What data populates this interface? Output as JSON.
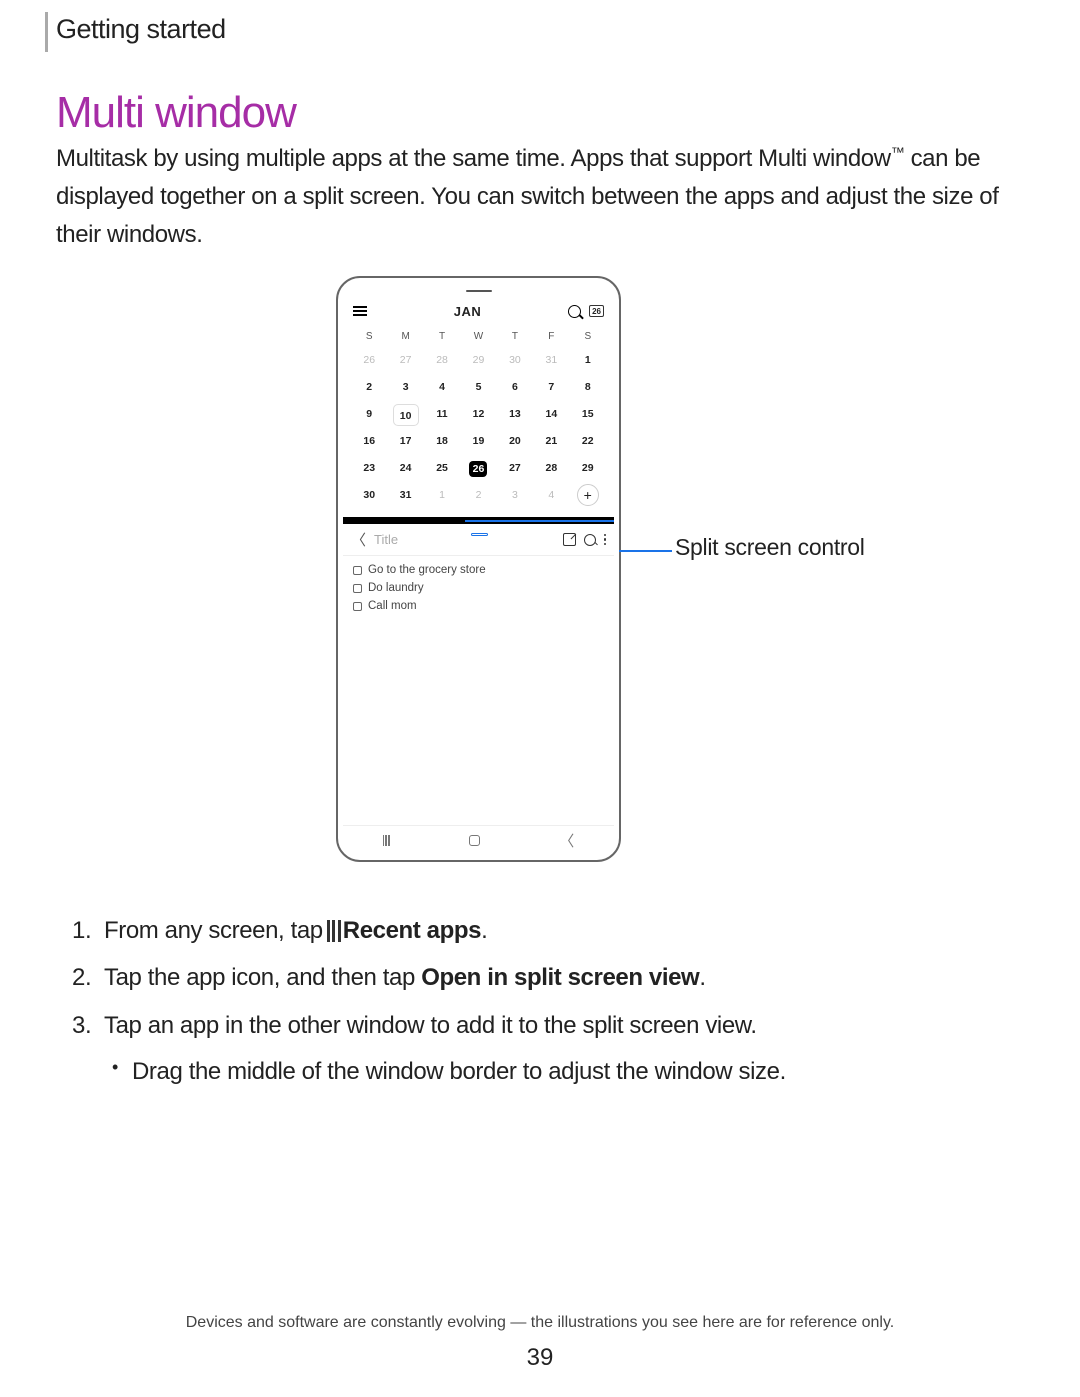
{
  "header": {
    "section": "Getting started"
  },
  "title": "Multi window",
  "intro": {
    "text1": "Multitask by using multiple apps at the same time. Apps that support Multi window",
    "tm": "™",
    "text2": "can be displayed together on a split screen. You can switch between the apps and adjust the size of their windows."
  },
  "callout": "Split screen control",
  "phone": {
    "calendar": {
      "month": "JAN",
      "today_badge": "26",
      "dow": [
        "S",
        "M",
        "T",
        "W",
        "T",
        "F",
        "S"
      ],
      "rows": [
        [
          {
            "d": "26",
            "dim": true
          },
          {
            "d": "27",
            "dim": true
          },
          {
            "d": "28",
            "dim": true
          },
          {
            "d": "29",
            "dim": true
          },
          {
            "d": "30",
            "dim": true
          },
          {
            "d": "31",
            "dim": true
          },
          {
            "d": "1"
          }
        ],
        [
          {
            "d": "2"
          },
          {
            "d": "3"
          },
          {
            "d": "4"
          },
          {
            "d": "5"
          },
          {
            "d": "6"
          },
          {
            "d": "7"
          },
          {
            "d": "8"
          }
        ],
        [
          {
            "d": "9"
          },
          {
            "d": "10",
            "sel": true
          },
          {
            "d": "11"
          },
          {
            "d": "12"
          },
          {
            "d": "13"
          },
          {
            "d": "14"
          },
          {
            "d": "15"
          }
        ],
        [
          {
            "d": "16"
          },
          {
            "d": "17"
          },
          {
            "d": "18"
          },
          {
            "d": "19"
          },
          {
            "d": "20"
          },
          {
            "d": "21"
          },
          {
            "d": "22"
          }
        ],
        [
          {
            "d": "23"
          },
          {
            "d": "24"
          },
          {
            "d": "25"
          },
          {
            "d": "26",
            "today": true
          },
          {
            "d": "27"
          },
          {
            "d": "28"
          },
          {
            "d": "29"
          }
        ],
        [
          {
            "d": "30"
          },
          {
            "d": "31"
          },
          {
            "d": "1",
            "dim": true
          },
          {
            "d": "2",
            "dim": true
          },
          {
            "d": "3",
            "dim": true
          },
          {
            "d": "4",
            "dim": true
          },
          {
            "d": "+",
            "add": true
          }
        ]
      ]
    },
    "notes": {
      "title_placeholder": "Title",
      "items": [
        "Go to the grocery store",
        "Do laundry",
        "Call mom"
      ]
    }
  },
  "steps": {
    "s1a": "From any screen, tap",
    "s1b": "Recent apps",
    "s1c": ".",
    "s2a": "Tap the app icon, and then tap ",
    "s2b": "Open in split screen view",
    "s2c": ".",
    "s3": "Tap an app in the other window to add it to the split screen view.",
    "s3sub": "Drag the middle of the window border to adjust the window size."
  },
  "footer": "Devices and software are constantly evolving — the illustrations you see here are for reference only.",
  "page": "39"
}
